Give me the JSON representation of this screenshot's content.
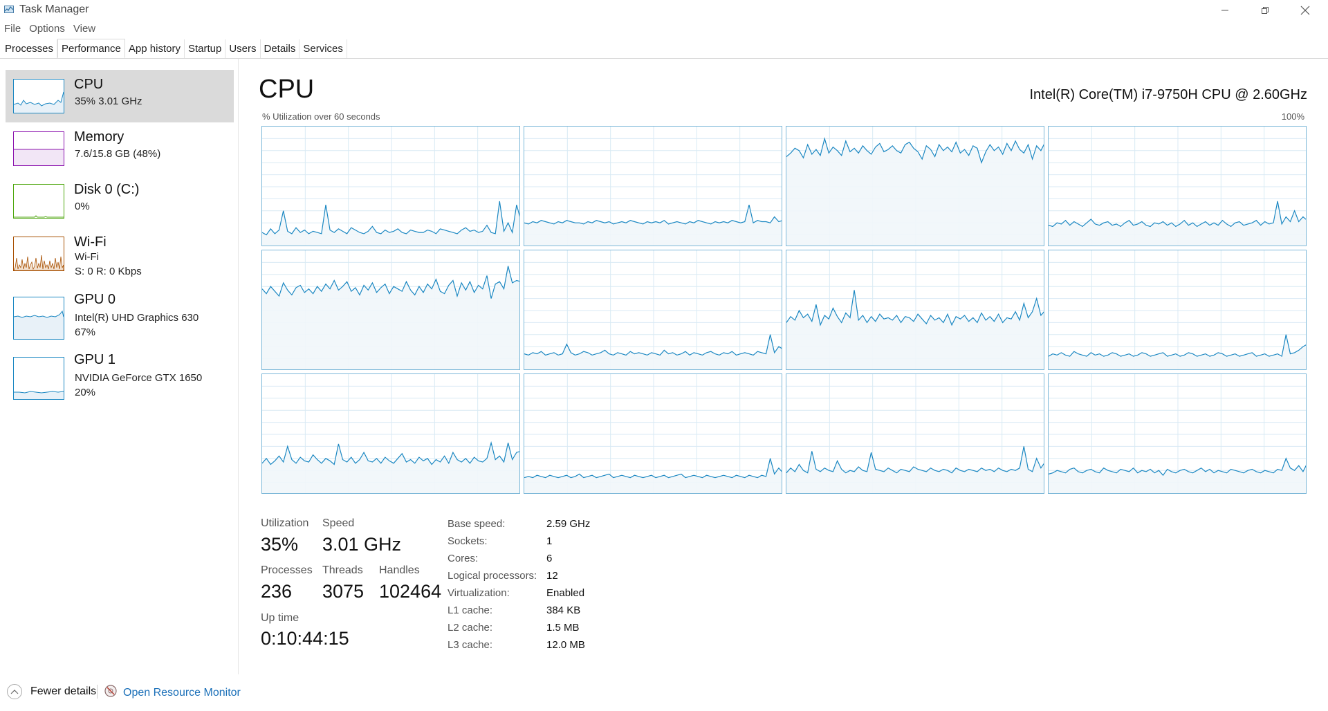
{
  "window": {
    "title": "Task Manager"
  },
  "menu": [
    "File",
    "Options",
    "View"
  ],
  "tabs": [
    {
      "label": "Processes",
      "active": false
    },
    {
      "label": "Performance",
      "active": true
    },
    {
      "label": "App history",
      "active": false
    },
    {
      "label": "Startup",
      "active": false
    },
    {
      "label": "Users",
      "active": false
    },
    {
      "label": "Details",
      "active": false
    },
    {
      "label": "Services",
      "active": false
    }
  ],
  "sidebar": {
    "items": [
      {
        "name": "CPU",
        "line1": "35% 3.01 GHz",
        "line2": "",
        "selected": true,
        "color": "#1a87c2"
      },
      {
        "name": "Memory",
        "line1": "7.6/15.8 GB (48%)",
        "line2": "",
        "selected": false,
        "color": "#8b12ae"
      },
      {
        "name": "Disk 0 (C:)",
        "line1": "0%",
        "line2": "",
        "selected": false,
        "color": "#4da60c"
      },
      {
        "name": "Wi-Fi",
        "line1": "Wi-Fi",
        "line2": "S: 0 R: 0 Kbps",
        "selected": false,
        "color": "#a74f01"
      },
      {
        "name": "GPU 0",
        "line1": "Intel(R) UHD Graphics 630",
        "line2": "67%",
        "selected": false,
        "color": "#1a87c2"
      },
      {
        "name": "GPU 1",
        "line1": "NVIDIA GeForce GTX 1650",
        "line2": "20%",
        "selected": false,
        "color": "#1a87c2"
      }
    ]
  },
  "main": {
    "title": "CPU",
    "model": "Intel(R) Core(TM) i7-9750H CPU @ 2.60GHz",
    "graph_caption": "% Utilization over 60 seconds",
    "graph_max": "100%",
    "stats": {
      "utilization_label": "Utilization",
      "utilization": "35%",
      "speed_label": "Speed",
      "speed": "3.01 GHz",
      "processes_label": "Processes",
      "processes": "236",
      "threads_label": "Threads",
      "threads": "3075",
      "handles_label": "Handles",
      "handles": "102464",
      "uptime_label": "Up time",
      "uptime": "0:10:44:15"
    },
    "info": [
      {
        "label": "Base speed:",
        "value": "2.59 GHz"
      },
      {
        "label": "Sockets:",
        "value": "1"
      },
      {
        "label": "Cores:",
        "value": "6"
      },
      {
        "label": "Logical processors:",
        "value": "12"
      },
      {
        "label": "Virtualization:",
        "value": "Enabled"
      },
      {
        "label": "L1 cache:",
        "value": "384 KB"
      },
      {
        "label": "L2 cache:",
        "value": "1.5 MB"
      },
      {
        "label": "L3 cache:",
        "value": "12.0 MB"
      }
    ]
  },
  "footer": {
    "fewer_details": "Fewer details",
    "resource_monitor": "Open Resource Monitor"
  },
  "colors": {
    "cpu_line": "#1a87c2",
    "cpu_fill": "#f1f6fa",
    "grid": "#d9eaf4",
    "link": "#1a6fb8"
  },
  "chart_data": {
    "type": "line",
    "ylim": [
      0,
      100
    ],
    "series": [
      {
        "values": [
          12,
          10,
          15,
          11,
          14,
          30,
          13,
          11,
          16,
          12,
          14,
          11,
          13,
          12,
          11,
          35,
          14,
          12,
          15,
          13,
          11,
          16,
          14,
          12,
          11,
          13,
          17,
          12,
          11,
          14,
          12,
          13,
          15,
          12,
          11,
          14,
          13,
          12,
          12,
          14,
          13,
          11,
          15,
          14,
          13,
          12,
          11,
          14,
          16,
          13,
          14,
          12,
          13,
          18,
          12,
          11,
          38,
          13,
          20,
          12,
          35,
          22
        ]
      },
      {
        "values": [
          20,
          19,
          21,
          20,
          22,
          21,
          20,
          19,
          21,
          20,
          22,
          21,
          20,
          20,
          19,
          21,
          20,
          22,
          21,
          20,
          21,
          19,
          20,
          21,
          20,
          22,
          21,
          20,
          19,
          21,
          20,
          21,
          20,
          22,
          19,
          20,
          21,
          20,
          19,
          21,
          20,
          22,
          21,
          20,
          19,
          21,
          20,
          21,
          20,
          22,
          21,
          20,
          21,
          35,
          20,
          22,
          21,
          21,
          20,
          25,
          21,
          22
        ]
      },
      {
        "values": [
          75,
          78,
          82,
          80,
          74,
          85,
          77,
          81,
          76,
          90,
          78,
          83,
          80,
          76,
          88,
          79,
          82,
          78,
          84,
          80,
          77,
          83,
          86,
          79,
          81,
          84,
          80,
          78,
          85,
          87,
          82,
          79,
          73,
          84,
          81,
          75,
          85,
          80,
          83,
          79,
          87,
          78,
          81,
          76,
          84,
          82,
          70,
          79,
          85,
          80,
          83,
          77,
          86,
          80,
          88,
          81,
          78,
          85,
          73,
          84,
          80,
          87
        ]
      },
      {
        "values": [
          18,
          17,
          20,
          19,
          22,
          18,
          21,
          19,
          17,
          20,
          23,
          19,
          18,
          20,
          21,
          18,
          19,
          17,
          20,
          22,
          18,
          19,
          21,
          18,
          17,
          20,
          19,
          21,
          18,
          20,
          17,
          19,
          22,
          18,
          20,
          17,
          19,
          21,
          18,
          20,
          18,
          22,
          19,
          17,
          20,
          21,
          18,
          19,
          20,
          22,
          18,
          21,
          19,
          20,
          38,
          19,
          25,
          21,
          30,
          21,
          25,
          22
        ]
      },
      {
        "values": [
          68,
          64,
          70,
          66,
          62,
          73,
          67,
          63,
          69,
          71,
          65,
          68,
          64,
          70,
          66,
          72,
          68,
          75,
          67,
          70,
          74,
          66,
          69,
          63,
          71,
          67,
          73,
          65,
          69,
          72,
          64,
          70,
          68,
          66,
          74,
          67,
          63,
          70,
          65,
          72,
          68,
          76,
          66,
          64,
          71,
          75,
          62,
          73,
          67,
          74,
          65,
          71,
          68,
          79,
          60,
          72,
          74,
          68,
          87,
          73,
          75,
          74
        ]
      },
      {
        "values": [
          14,
          13,
          15,
          14,
          16,
          13,
          14,
          15,
          13,
          14,
          22,
          15,
          13,
          14,
          16,
          15,
          13,
          14,
          15,
          17,
          14,
          13,
          15,
          14,
          13,
          16,
          14,
          15,
          14,
          13,
          15,
          14,
          13,
          17,
          14,
          15,
          13,
          14,
          16,
          13,
          15,
          14,
          13,
          15,
          16,
          14,
          13,
          15,
          14,
          16,
          13,
          14,
          15,
          14,
          13,
          16,
          15,
          14,
          30,
          15,
          20,
          18
        ]
      },
      {
        "values": [
          40,
          45,
          42,
          50,
          44,
          47,
          41,
          55,
          38,
          46,
          43,
          52,
          45,
          40,
          48,
          44,
          67,
          42,
          46,
          40,
          45,
          41,
          47,
          43,
          44,
          42,
          46,
          40,
          45,
          44,
          41,
          47,
          43,
          39,
          46,
          42,
          44,
          40,
          47,
          38,
          45,
          43,
          46,
          41,
          44,
          40,
          48,
          42,
          45,
          41,
          47,
          40,
          44,
          43,
          49,
          42,
          56,
          44,
          49,
          60,
          46,
          50
        ]
      },
      {
        "values": [
          12,
          14,
          13,
          15,
          13,
          12,
          16,
          14,
          13,
          12,
          15,
          13,
          14,
          12,
          13,
          15,
          14,
          12,
          13,
          14,
          12,
          13,
          15,
          14,
          12,
          13,
          14,
          15,
          12,
          13,
          14,
          12,
          13,
          15,
          14,
          12,
          13,
          14,
          12,
          13,
          15,
          14,
          12,
          13,
          14,
          12,
          13,
          14,
          15,
          12,
          13,
          14,
          12,
          13,
          14,
          12,
          30,
          14,
          15,
          17,
          20,
          22
        ]
      },
      {
        "values": [
          26,
          30,
          25,
          28,
          32,
          27,
          40,
          29,
          26,
          31,
          28,
          27,
          33,
          29,
          26,
          30,
          28,
          25,
          42,
          29,
          27,
          31,
          26,
          29,
          35,
          28,
          27,
          30,
          26,
          31,
          28,
          26,
          30,
          34,
          27,
          29,
          26,
          31,
          28,
          30,
          25,
          29,
          27,
          32,
          26,
          35,
          29,
          27,
          30,
          26,
          31,
          28,
          27,
          30,
          43,
          29,
          32,
          27,
          43,
          29,
          35,
          36
        ]
      },
      {
        "values": [
          14,
          15,
          14,
          16,
          15,
          14,
          16,
          15,
          14,
          15,
          16,
          14,
          15,
          17,
          14,
          15,
          16,
          14,
          15,
          16,
          17,
          14,
          15,
          16,
          15,
          14,
          16,
          15,
          14,
          15,
          16,
          14,
          15,
          16,
          14,
          15,
          16,
          17,
          14,
          15,
          16,
          15,
          14,
          16,
          15,
          14,
          15,
          16,
          15,
          14,
          16,
          15,
          14,
          16,
          15,
          14,
          16,
          15,
          30,
          17,
          22,
          18
        ]
      },
      {
        "values": [
          18,
          22,
          19,
          25,
          20,
          18,
          36,
          21,
          19,
          22,
          20,
          19,
          28,
          21,
          18,
          20,
          19,
          23,
          20,
          19,
          35,
          21,
          20,
          19,
          22,
          20,
          18,
          21,
          20,
          19,
          23,
          21,
          20,
          19,
          22,
          20,
          19,
          21,
          20,
          18,
          22,
          20,
          19,
          21,
          20,
          19,
          22,
          20,
          21,
          19,
          22,
          20,
          19,
          21,
          20,
          22,
          40,
          21,
          19,
          30,
          22,
          27
        ]
      },
      {
        "values": [
          17,
          18,
          20,
          19,
          18,
          21,
          22,
          19,
          18,
          20,
          21,
          19,
          18,
          22,
          20,
          19,
          18,
          21,
          20,
          19,
          22,
          18,
          20,
          19,
          21,
          18,
          20,
          16,
          21,
          19,
          18,
          20,
          21,
          19,
          18,
          20,
          22,
          19,
          21,
          18,
          20,
          19,
          18,
          21,
          20,
          19,
          18,
          20,
          21,
          19,
          18,
          20,
          19,
          18,
          21,
          20,
          30,
          22,
          20,
          24,
          19,
          26
        ]
      }
    ]
  }
}
